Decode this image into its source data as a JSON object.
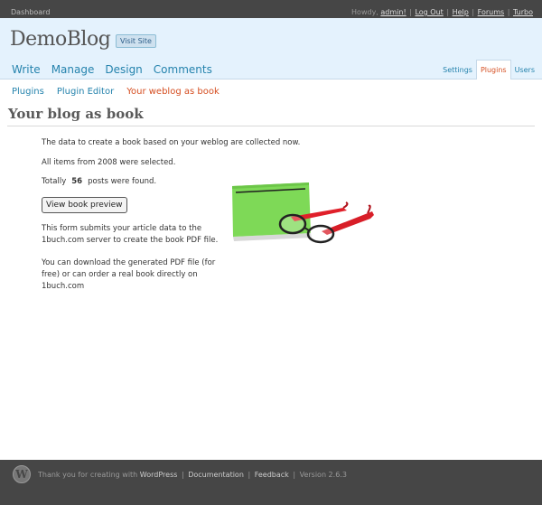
{
  "topbar": {
    "dashboard": "Dashboard",
    "howdy": "Howdy,",
    "user": "admin!",
    "links": [
      "Log Out",
      "Help",
      "Forums",
      "Turbo"
    ]
  },
  "header": {
    "blog_title": "DemoBlog",
    "visit_site": "Visit Site",
    "nav": [
      "Write",
      "Manage",
      "Design",
      "Comments"
    ],
    "right_tabs": [
      {
        "label": "Settings",
        "active": false
      },
      {
        "label": "Plugins",
        "active": true
      },
      {
        "label": "Users",
        "active": false
      }
    ]
  },
  "subnav": [
    {
      "label": "Plugins",
      "active": false
    },
    {
      "label": "Plugin Editor",
      "active": false
    },
    {
      "label": "Your weblog as book",
      "active": true
    }
  ],
  "page": {
    "title": "Your blog as book",
    "line1": "The data to create a book based on your weblog are collected now.",
    "line2": "All items from 2008 were selected.",
    "totally": "Totally",
    "post_count": "56",
    "posts_found": "posts were found.",
    "preview_button": "View book preview",
    "para1": "This form submits your article data to the 1buch.com server to create the book PDF file.",
    "para2": "You can download the generated PDF file (for free) or can order a real book directly on 1buch.com"
  },
  "footer": {
    "thanks": "Thank you for creating with",
    "wordpress": "WordPress",
    "documentation": "Documentation",
    "feedback": "Feedback",
    "version": "Version 2.6.3"
  },
  "colors": {
    "topbar_bg": "#464646",
    "header_bg": "#e4f2fd",
    "link": "#2583ad",
    "active": "#d54e21",
    "book_green": "#7ed957",
    "glasses_red": "#e0202a"
  }
}
